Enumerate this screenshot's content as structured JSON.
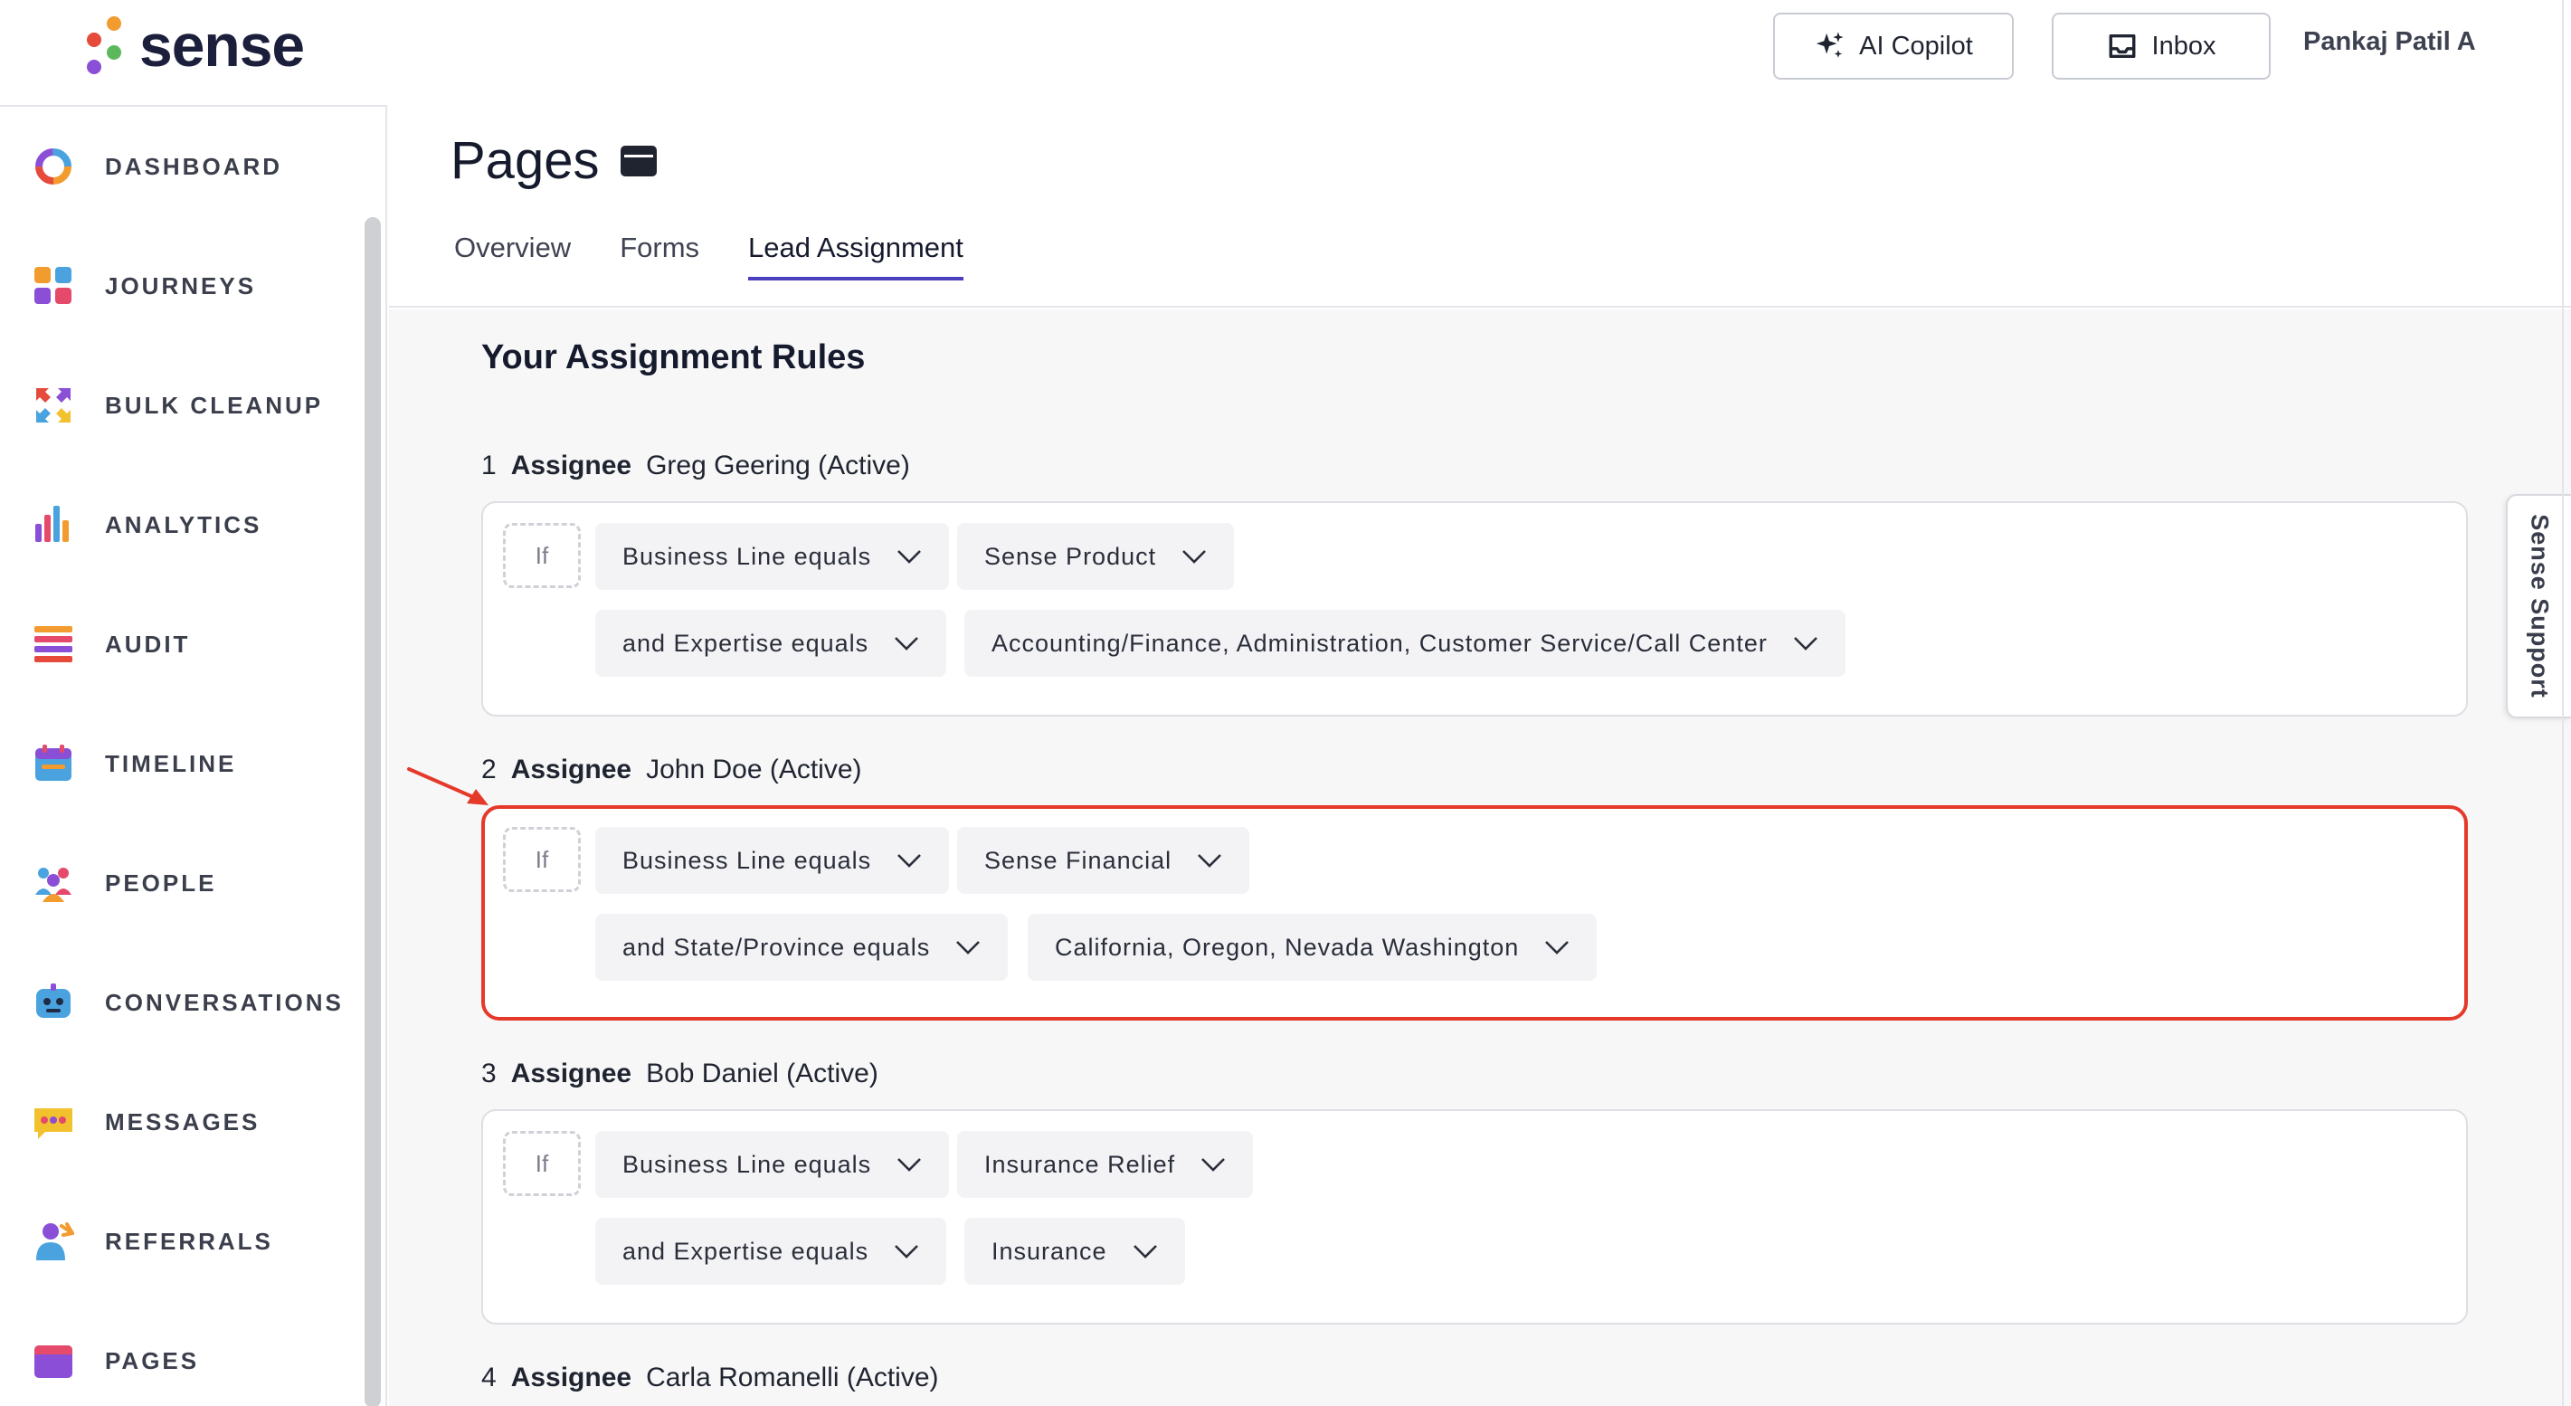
{
  "app": {
    "logo_text": "sense"
  },
  "header": {
    "copilot_label": "AI Copilot",
    "inbox_label": "Inbox",
    "user_name": "Pankaj Patil A"
  },
  "sidebar": {
    "items": [
      {
        "label": "DASHBOARD",
        "icon": "dashboard-icon"
      },
      {
        "label": "JOURNEYS",
        "icon": "journeys-icon"
      },
      {
        "label": "BULK CLEANUP",
        "icon": "bulk-cleanup-icon"
      },
      {
        "label": "ANALYTICS",
        "icon": "analytics-icon"
      },
      {
        "label": "AUDIT",
        "icon": "audit-icon"
      },
      {
        "label": "TIMELINE",
        "icon": "timeline-icon"
      },
      {
        "label": "PEOPLE",
        "icon": "people-icon"
      },
      {
        "label": "CONVERSATIONS",
        "icon": "conversations-icon"
      },
      {
        "label": "MESSAGES",
        "icon": "messages-icon"
      },
      {
        "label": "REFERRALS",
        "icon": "referrals-icon"
      },
      {
        "label": "PAGES",
        "icon": "pages-icon"
      }
    ]
  },
  "page": {
    "title": "Pages",
    "tabs": [
      "Overview",
      "Forms",
      "Lead Assignment"
    ],
    "active_tab": "Lead Assignment",
    "section_title": "Your Assignment Rules"
  },
  "rules": [
    {
      "number": "1",
      "assignee_label": "Assignee",
      "assignee": "Greg Geering (Active)",
      "if_label": "If",
      "row1": {
        "field": "Business Line equals",
        "value": "Sense Product"
      },
      "row2": {
        "field": "and Expertise equals",
        "value": "Accounting/Finance, Administration, Customer Service/Call Center"
      }
    },
    {
      "number": "2",
      "assignee_label": "Assignee",
      "assignee": "John Doe (Active)",
      "if_label": "If",
      "row1": {
        "field": "Business Line equals",
        "value": "Sense Financial"
      },
      "row2": {
        "field": "and State/Province equals",
        "value": "California, Oregon, Nevada Washington"
      }
    },
    {
      "number": "3",
      "assignee_label": "Assignee",
      "assignee": "Bob Daniel (Active)",
      "if_label": "If",
      "row1": {
        "field": "Business Line equals",
        "value": "Insurance Relief"
      },
      "row2": {
        "field": "and Expertise equals",
        "value": "Insurance"
      }
    },
    {
      "number": "4",
      "assignee_label": "Assignee",
      "assignee": "Carla Romanelli (Active)"
    }
  ],
  "support": {
    "label": "Sense Support"
  },
  "colors": {
    "accent": "#4b3fbf",
    "highlight": "#e5392a"
  }
}
